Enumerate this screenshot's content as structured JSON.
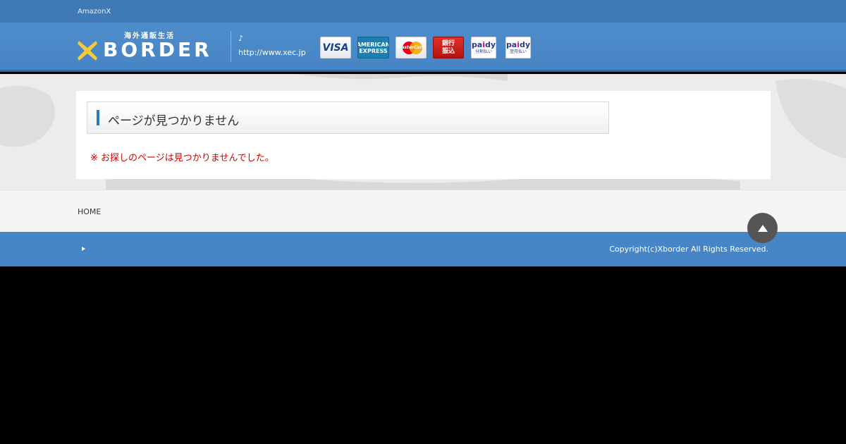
{
  "topbar": {
    "title": "AmazonX"
  },
  "header": {
    "logo_sub": "海外通販生活",
    "logo_word": "BORDER",
    "music_note": "♪",
    "site_url": "http://www.xec.jp",
    "payments": {
      "visa": "VISA",
      "amex_line1": "AMERICAN",
      "amex_line2": "EXPRESS",
      "master": "MasterCard",
      "bank_line1": "銀行",
      "bank_line2": "振込",
      "paidy_pre": "pa",
      "paidy_mid": "i",
      "paidy_post": "dy",
      "paidy1_sub": "分割払い",
      "paidy2_sub": "翌月払い"
    }
  },
  "main": {
    "heading": "ページが見つかりません",
    "notice": "※ お探しのページは見つかりませんでした。"
  },
  "footer": {
    "home_link": "HOME",
    "copyright": "Copyright(c)Xborder All Rights Reserved."
  },
  "colors": {
    "topbar": "#3f7ab6",
    "header": "#4e8dcb",
    "logo_x": "#f5c93b",
    "heading_bar": "#2c7bb4",
    "notice": "#d40000",
    "footer_bar": "#4686c6"
  },
  "icons": {
    "logo": "x-logo-icon",
    "totop": "arrow-up-icon",
    "footer_arrow": "triangle-right-icon"
  }
}
